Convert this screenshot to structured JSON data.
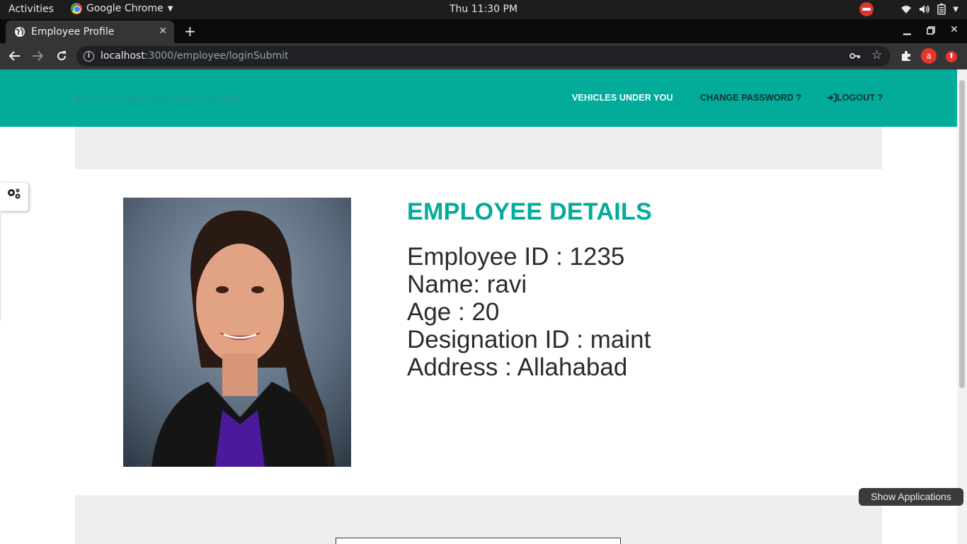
{
  "os_topbar": {
    "activities": "Activities",
    "app_name": "Google Chrome",
    "clock": "Thu 11:30 PM",
    "icons": [
      "do-not-disturb-icon",
      "wifi-icon",
      "volume-icon",
      "battery-icon",
      "system-menu-icon"
    ]
  },
  "browser": {
    "tab_title": "Employee Profile",
    "new_tab": "+",
    "url_host": "localhost",
    "url_path": ":3000/employee/loginSubmit",
    "profile_initial": "a"
  },
  "site": {
    "brand": "Vehicle Management System",
    "nav": {
      "vehicles": "VEHICLES UNDER YOU",
      "change_password": "CHANGE PASSWORD ?",
      "logout": "LOGOUT ?"
    },
    "details_title": "EMPLOYEE DETAILS",
    "details": [
      "Employee ID : 1235",
      "Name: ravi",
      "Age : 20",
      "Designation ID : maint",
      "Address : Allahabad"
    ]
  },
  "os_overlay": {
    "show_applications": "Show Applications"
  },
  "colors": {
    "accent": "#02ab9a",
    "band": "#eeeeee",
    "text": "#2b2b2b"
  }
}
